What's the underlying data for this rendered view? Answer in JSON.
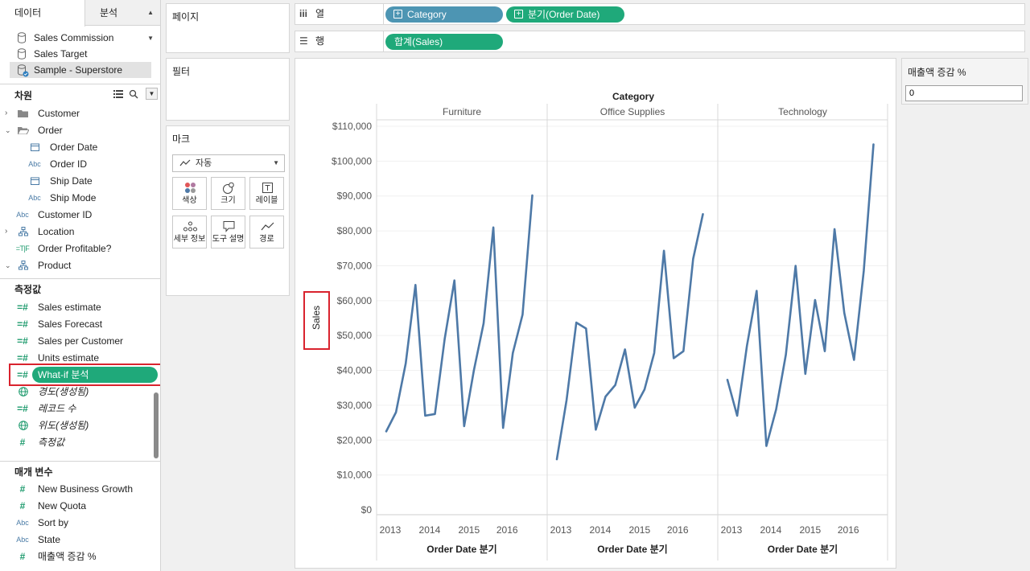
{
  "left_tabs": {
    "data": "데이터",
    "analysis": "분석"
  },
  "datasources": [
    "Sales Commission",
    "Sales Target",
    "Sample - Superstore"
  ],
  "dimensions": {
    "header": "차원",
    "items": [
      "Customer",
      "Order",
      "Order Date",
      "Order ID",
      "Ship Date",
      "Ship Mode",
      "Customer ID",
      "Location",
      "Order Profitable?",
      "Product"
    ]
  },
  "measures": {
    "header": "측정값",
    "items": [
      "Sales estimate",
      "Sales Forecast",
      "Sales per Customer",
      "Units estimate",
      "What-if 분석",
      "경도(생성됨)",
      "레코드 수",
      "위도(생성됨)",
      "측정값"
    ]
  },
  "parameters": {
    "header": "매개 변수",
    "items": [
      "New Business Growth",
      "New Quota",
      "Sort by",
      "State",
      "매출액 증감 %"
    ]
  },
  "cards": {
    "pages": "페이지",
    "filters": "필터",
    "marks": "마크"
  },
  "marks": {
    "type": "자동",
    "buttons": [
      "색상",
      "크기",
      "레이블",
      "세부 정보",
      "도구 설명",
      "경로"
    ]
  },
  "shelves": {
    "columns_label": "열",
    "rows_label": "행",
    "columns_pills": [
      "Category",
      "분기(Order Date)"
    ],
    "rows_pills": [
      "합계(Sales)"
    ]
  },
  "parameter_card": {
    "title": "매출액 증감 %",
    "value": "0"
  },
  "colors": {
    "line": "#4e79a7",
    "pill_green": "#1fa97a",
    "pill_blue": "#4d95b3",
    "highlight": "#d9232e"
  },
  "chart_data": {
    "type": "line",
    "title": "Category",
    "ylabel": "Sales",
    "xlabel": "Order Date 분기",
    "ylim": [
      0,
      110000
    ],
    "yticks": [
      "$110,000",
      "$100,000",
      "$90,000",
      "$80,000",
      "$70,000",
      "$60,000",
      "$50,000",
      "$40,000",
      "$30,000",
      "$20,000",
      "$10,000",
      "$0"
    ],
    "xticks": [
      "2013",
      "2014",
      "2015",
      "2016"
    ],
    "categories": [
      "Furniture",
      "Office Supplies",
      "Technology"
    ],
    "x": [
      "2013 Q1",
      "2013 Q2",
      "2013 Q3",
      "2013 Q4",
      "2014 Q1",
      "2014 Q2",
      "2014 Q3",
      "2014 Q4",
      "2015 Q1",
      "2015 Q2",
      "2015 Q3",
      "2015 Q4",
      "2016 Q1",
      "2016 Q2",
      "2016 Q3",
      "2016 Q4"
    ],
    "series": [
      {
        "panel": "Furniture",
        "values": [
          22500,
          28000,
          42000,
          64500,
          27000,
          27500,
          49000,
          65800,
          24000,
          40000,
          53500,
          81000,
          23500,
          45000,
          56000,
          90200
        ]
      },
      {
        "panel": "Office Supplies",
        "values": [
          14500,
          31500,
          53700,
          52000,
          23000,
          32500,
          35800,
          46000,
          29300,
          34500,
          45000,
          74300,
          43500,
          45500,
          72000,
          84800
        ]
      },
      {
        "panel": "Technology",
        "values": [
          37300,
          27000,
          47000,
          62800,
          18300,
          28800,
          44500,
          70000,
          39000,
          60200,
          45500,
          80500,
          56500,
          43000,
          68500,
          104800
        ]
      }
    ]
  }
}
